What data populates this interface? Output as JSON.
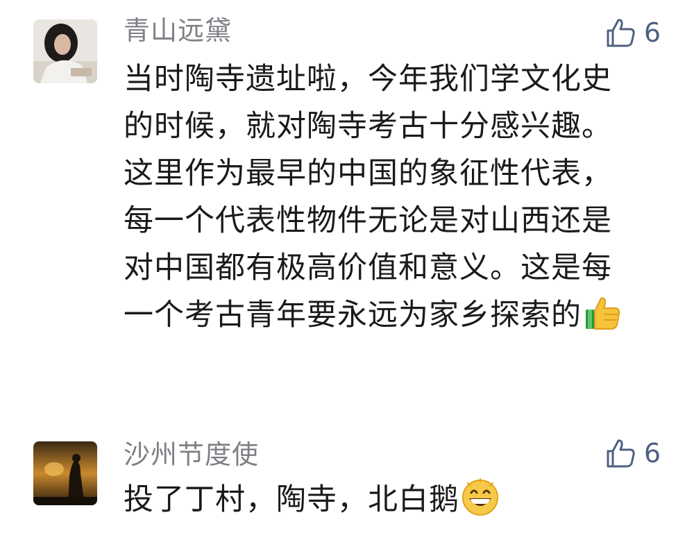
{
  "comments": [
    {
      "username": "青山远黛",
      "like_count": "6",
      "text": "当时陶寺遗址啦，今年我们学文化史的时候，就对陶寺考古十分感兴趣。这里作为最早的中国的象征性代表，每一个代表性物件无论是对山西还是对中国都有极高价值和意义。这是每一个考古青年要永远为家乡探索的",
      "trailing_emoji": "thumbs-up-emoji"
    },
    {
      "username": "沙州节度使",
      "like_count": "6",
      "text": "投了丁村，陶寺，北白鹅",
      "trailing_emoji": "grinning-face-emoji"
    }
  ]
}
